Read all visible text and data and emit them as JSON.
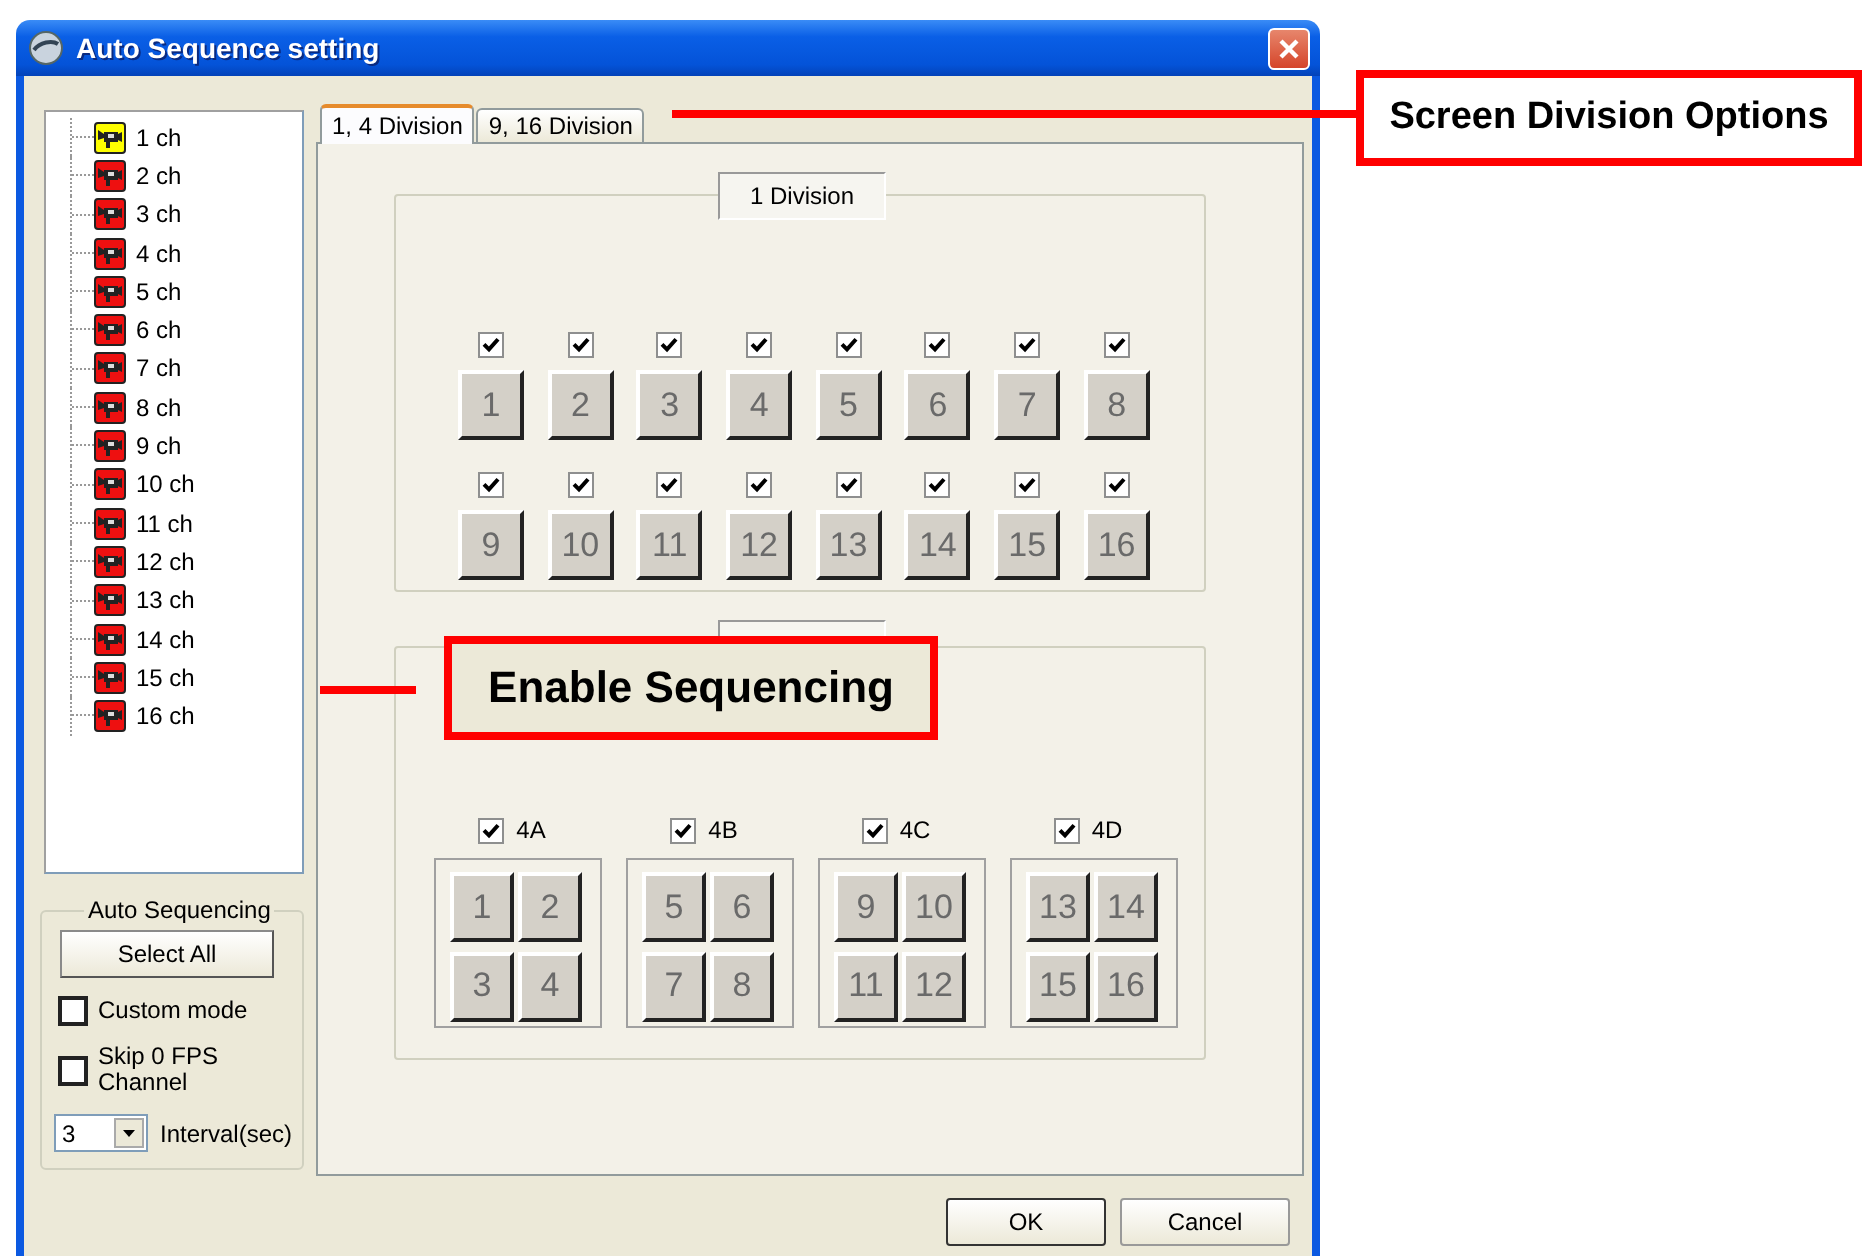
{
  "window": {
    "title": "Auto Sequence setting"
  },
  "channels": [
    {
      "label": "1 ch",
      "selected": true
    },
    {
      "label": "2 ch",
      "selected": false
    },
    {
      "label": "3 ch",
      "selected": false
    },
    {
      "label": "4 ch",
      "selected": false
    },
    {
      "label": "5 ch",
      "selected": false
    },
    {
      "label": "6 ch",
      "selected": false
    },
    {
      "label": "7 ch",
      "selected": false
    },
    {
      "label": "8 ch",
      "selected": false
    },
    {
      "label": "9 ch",
      "selected": false
    },
    {
      "label": "10 ch",
      "selected": false
    },
    {
      "label": "11 ch",
      "selected": false
    },
    {
      "label": "12 ch",
      "selected": false
    },
    {
      "label": "13 ch",
      "selected": false
    },
    {
      "label": "14 ch",
      "selected": false
    },
    {
      "label": "15 ch",
      "selected": false
    },
    {
      "label": "16 ch",
      "selected": false
    }
  ],
  "auto_sequencing": {
    "title": "Auto Sequencing",
    "select_all": "Select All",
    "options": [
      {
        "label": "Custom mode",
        "checked": false
      },
      {
        "label": "Skip 0 FPS Channel",
        "checked": false
      }
    ],
    "interval": {
      "value": "3",
      "label": "Interval(sec)"
    }
  },
  "tabs": [
    {
      "label": "1, 4 Division",
      "selected": true
    },
    {
      "label": "9, 16 Division",
      "selected": false
    }
  ],
  "division_1": {
    "title": "1 Division",
    "cells": [
      {
        "label": "1",
        "checked": true
      },
      {
        "label": "2",
        "checked": true
      },
      {
        "label": "3",
        "checked": true
      },
      {
        "label": "4",
        "checked": true
      },
      {
        "label": "5",
        "checked": true
      },
      {
        "label": "6",
        "checked": true
      },
      {
        "label": "7",
        "checked": true
      },
      {
        "label": "8",
        "checked": true
      },
      {
        "label": "9",
        "checked": true
      },
      {
        "label": "10",
        "checked": true
      },
      {
        "label": "11",
        "checked": true
      },
      {
        "label": "12",
        "checked": true
      },
      {
        "label": "13",
        "checked": true
      },
      {
        "label": "14",
        "checked": true
      },
      {
        "label": "15",
        "checked": true
      },
      {
        "label": "16",
        "checked": true
      }
    ]
  },
  "division_4": {
    "groups": [
      {
        "label": "4A",
        "checked": true,
        "cells": [
          "1",
          "2",
          "3",
          "4"
        ]
      },
      {
        "label": "4B",
        "checked": true,
        "cells": [
          "5",
          "6",
          "7",
          "8"
        ]
      },
      {
        "label": "4C",
        "checked": true,
        "cells": [
          "9",
          "10",
          "11",
          "12"
        ]
      },
      {
        "label": "4D",
        "checked": true,
        "cells": [
          "13",
          "14",
          "15",
          "16"
        ]
      }
    ]
  },
  "buttons": [
    "OK",
    "Cancel"
  ],
  "callouts": [
    {
      "text": "Screen Division Options"
    },
    {
      "text": "Enable Sequencing"
    }
  ]
}
